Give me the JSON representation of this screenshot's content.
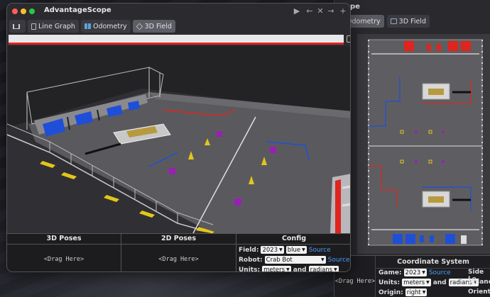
{
  "main_window": {
    "title": "AdvantageScope",
    "tabs": [
      {
        "label": ""
      },
      {
        "label": "Line Graph"
      },
      {
        "label": "Odometry"
      },
      {
        "label": "3D Field"
      }
    ],
    "bottom": {
      "poses3d": {
        "title": "3D Poses",
        "placeholder": "<Drag Here>"
      },
      "poses2d": {
        "title": "2D Poses",
        "placeholder": "<Drag Here>"
      },
      "config": {
        "title": "Config",
        "field_label": "Field:",
        "field_year": "2023",
        "field_alliance": "blue",
        "field_source": "Source",
        "robot_label": "Robot:",
        "robot_value": "Crab Bot",
        "robot_source": "Source",
        "units_label": "Units:",
        "units_distance": "meters",
        "units_and": "and",
        "units_angle": "radians"
      }
    }
  },
  "back_window": {
    "title_fragment": "pe",
    "tabs": [
      {
        "label": "Odometry"
      },
      {
        "label": "3D Field"
      }
    ],
    "config": {
      "title": "Coordinate System",
      "game_label": "Game:",
      "game_value": "2023",
      "game_source": "Source",
      "units_label": "Units:",
      "units_distance": "meters",
      "units_and": "and",
      "units_angle": "radians",
      "origin_label": "Origin:",
      "origin_value": "right",
      "side_label_1": "Side Le",
      "side_label_2": "Allianc",
      "side_label_3": "Orientat",
      "placeholder": "<Drag Here>"
    }
  },
  "colors": {
    "alliance_red": "#e0241e",
    "alliance_blue": "#1f4fd8",
    "cone_yellow": "#e3c61a",
    "cube_purple": "#9a1fb5",
    "link_blue": "#4a9cf5"
  }
}
